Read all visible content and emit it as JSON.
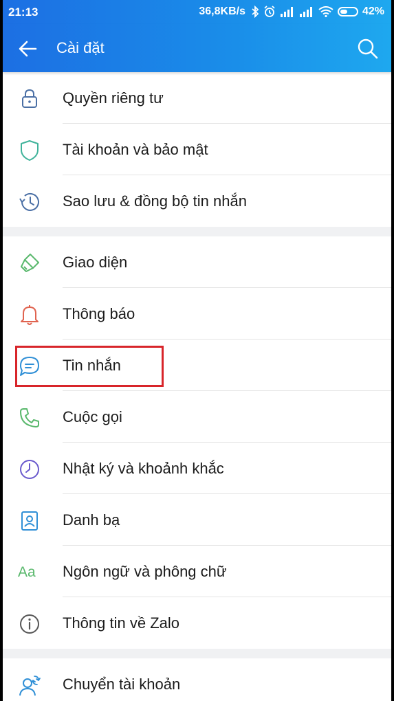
{
  "status_bar": {
    "time": "21:13",
    "speed": "36,8KB/s",
    "battery_percent": "42%"
  },
  "app_bar": {
    "title": "Cài đặt",
    "back_icon": "arrow-left-icon",
    "search_icon": "search-icon"
  },
  "sections": [
    {
      "items": [
        {
          "label": "Quyền riêng tư",
          "icon": "lock-icon",
          "color": "#4a6fa5"
        },
        {
          "label": "Tài khoản và bảo mật",
          "icon": "shield-icon",
          "color": "#3fb39a"
        },
        {
          "label": "Sao lưu & đồng bộ tin nhắn",
          "icon": "history-icon",
          "color": "#4a6fa5"
        }
      ]
    },
    {
      "items": [
        {
          "label": "Giao diện",
          "icon": "paint-brush-icon",
          "color": "#59b86c"
        },
        {
          "label": "Thông báo",
          "icon": "bell-icon",
          "color": "#e0634f"
        },
        {
          "label": "Tin nhắn",
          "icon": "chat-bubble-icon",
          "color": "#2f8fd6",
          "highlighted": true
        },
        {
          "label": "Cuộc gọi",
          "icon": "phone-icon",
          "color": "#59b86c"
        },
        {
          "label": "Nhật ký và khoảnh khắc",
          "icon": "clock-icon",
          "color": "#6a5acd"
        },
        {
          "label": "Danh bạ",
          "icon": "contacts-icon",
          "color": "#2f8fd6"
        },
        {
          "label": "Ngôn ngữ và phông chữ",
          "icon": "font-aa-icon",
          "color": "#59b86c",
          "glyph": "Aa"
        },
        {
          "label": "Thông tin về Zalo",
          "icon": "info-icon",
          "color": "#555555"
        }
      ]
    },
    {
      "items": [
        {
          "label": "Chuyển tài khoản",
          "icon": "switch-account-icon",
          "color": "#2f8fd6"
        }
      ]
    }
  ]
}
